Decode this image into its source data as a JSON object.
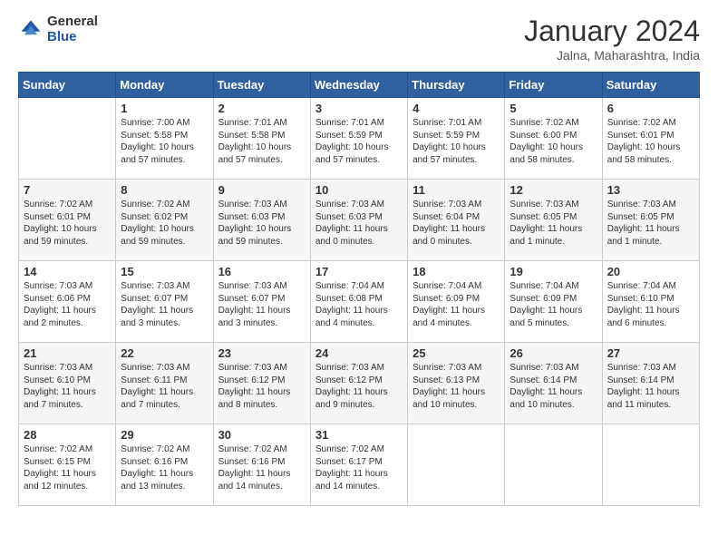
{
  "header": {
    "logo": {
      "general": "General",
      "blue": "Blue"
    },
    "title": "January 2024",
    "location": "Jalna, Maharashtra, India"
  },
  "weekdays": [
    "Sunday",
    "Monday",
    "Tuesday",
    "Wednesday",
    "Thursday",
    "Friday",
    "Saturday"
  ],
  "weeks": [
    [
      {
        "day": "",
        "info": ""
      },
      {
        "day": "1",
        "info": "Sunrise: 7:00 AM\nSunset: 5:58 PM\nDaylight: 10 hours\nand 57 minutes."
      },
      {
        "day": "2",
        "info": "Sunrise: 7:01 AM\nSunset: 5:58 PM\nDaylight: 10 hours\nand 57 minutes."
      },
      {
        "day": "3",
        "info": "Sunrise: 7:01 AM\nSunset: 5:59 PM\nDaylight: 10 hours\nand 57 minutes."
      },
      {
        "day": "4",
        "info": "Sunrise: 7:01 AM\nSunset: 5:59 PM\nDaylight: 10 hours\nand 57 minutes."
      },
      {
        "day": "5",
        "info": "Sunrise: 7:02 AM\nSunset: 6:00 PM\nDaylight: 10 hours\nand 58 minutes."
      },
      {
        "day": "6",
        "info": "Sunrise: 7:02 AM\nSunset: 6:01 PM\nDaylight: 10 hours\nand 58 minutes."
      }
    ],
    [
      {
        "day": "7",
        "info": "Sunrise: 7:02 AM\nSunset: 6:01 PM\nDaylight: 10 hours\nand 59 minutes."
      },
      {
        "day": "8",
        "info": "Sunrise: 7:02 AM\nSunset: 6:02 PM\nDaylight: 10 hours\nand 59 minutes."
      },
      {
        "day": "9",
        "info": "Sunrise: 7:03 AM\nSunset: 6:03 PM\nDaylight: 10 hours\nand 59 minutes."
      },
      {
        "day": "10",
        "info": "Sunrise: 7:03 AM\nSunset: 6:03 PM\nDaylight: 11 hours\nand 0 minutes."
      },
      {
        "day": "11",
        "info": "Sunrise: 7:03 AM\nSunset: 6:04 PM\nDaylight: 11 hours\nand 0 minutes."
      },
      {
        "day": "12",
        "info": "Sunrise: 7:03 AM\nSunset: 6:05 PM\nDaylight: 11 hours\nand 1 minute."
      },
      {
        "day": "13",
        "info": "Sunrise: 7:03 AM\nSunset: 6:05 PM\nDaylight: 11 hours\nand 1 minute."
      }
    ],
    [
      {
        "day": "14",
        "info": "Sunrise: 7:03 AM\nSunset: 6:06 PM\nDaylight: 11 hours\nand 2 minutes."
      },
      {
        "day": "15",
        "info": "Sunrise: 7:03 AM\nSunset: 6:07 PM\nDaylight: 11 hours\nand 3 minutes."
      },
      {
        "day": "16",
        "info": "Sunrise: 7:03 AM\nSunset: 6:07 PM\nDaylight: 11 hours\nand 3 minutes."
      },
      {
        "day": "17",
        "info": "Sunrise: 7:04 AM\nSunset: 6:08 PM\nDaylight: 11 hours\nand 4 minutes."
      },
      {
        "day": "18",
        "info": "Sunrise: 7:04 AM\nSunset: 6:09 PM\nDaylight: 11 hours\nand 4 minutes."
      },
      {
        "day": "19",
        "info": "Sunrise: 7:04 AM\nSunset: 6:09 PM\nDaylight: 11 hours\nand 5 minutes."
      },
      {
        "day": "20",
        "info": "Sunrise: 7:04 AM\nSunset: 6:10 PM\nDaylight: 11 hours\nand 6 minutes."
      }
    ],
    [
      {
        "day": "21",
        "info": "Sunrise: 7:03 AM\nSunset: 6:10 PM\nDaylight: 11 hours\nand 7 minutes."
      },
      {
        "day": "22",
        "info": "Sunrise: 7:03 AM\nSunset: 6:11 PM\nDaylight: 11 hours\nand 7 minutes."
      },
      {
        "day": "23",
        "info": "Sunrise: 7:03 AM\nSunset: 6:12 PM\nDaylight: 11 hours\nand 8 minutes."
      },
      {
        "day": "24",
        "info": "Sunrise: 7:03 AM\nSunset: 6:12 PM\nDaylight: 11 hours\nand 9 minutes."
      },
      {
        "day": "25",
        "info": "Sunrise: 7:03 AM\nSunset: 6:13 PM\nDaylight: 11 hours\nand 10 minutes."
      },
      {
        "day": "26",
        "info": "Sunrise: 7:03 AM\nSunset: 6:14 PM\nDaylight: 11 hours\nand 10 minutes."
      },
      {
        "day": "27",
        "info": "Sunrise: 7:03 AM\nSunset: 6:14 PM\nDaylight: 11 hours\nand 11 minutes."
      }
    ],
    [
      {
        "day": "28",
        "info": "Sunrise: 7:02 AM\nSunset: 6:15 PM\nDaylight: 11 hours\nand 12 minutes."
      },
      {
        "day": "29",
        "info": "Sunrise: 7:02 AM\nSunset: 6:16 PM\nDaylight: 11 hours\nand 13 minutes."
      },
      {
        "day": "30",
        "info": "Sunrise: 7:02 AM\nSunset: 6:16 PM\nDaylight: 11 hours\nand 14 minutes."
      },
      {
        "day": "31",
        "info": "Sunrise: 7:02 AM\nSunset: 6:17 PM\nDaylight: 11 hours\nand 14 minutes."
      },
      {
        "day": "",
        "info": ""
      },
      {
        "day": "",
        "info": ""
      },
      {
        "day": "",
        "info": ""
      }
    ]
  ]
}
